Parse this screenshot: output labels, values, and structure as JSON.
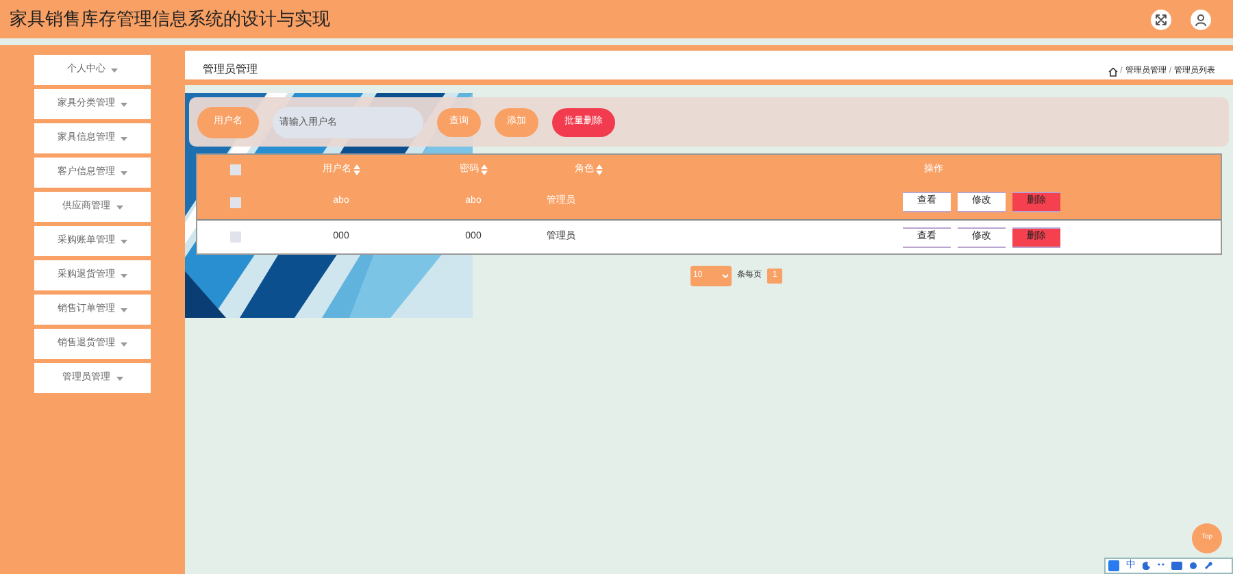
{
  "header": {
    "title": "家具销售库存管理信息系统的设计与实现"
  },
  "sidebar": {
    "items": [
      {
        "label": "个人中心"
      },
      {
        "label": "家具分类管理"
      },
      {
        "label": "家具信息管理"
      },
      {
        "label": "客户信息管理"
      },
      {
        "label": "供应商管理"
      },
      {
        "label": "采购账单管理"
      },
      {
        "label": "采购退货管理"
      },
      {
        "label": "销售订单管理"
      },
      {
        "label": "销售退货管理"
      },
      {
        "label": "管理员管理"
      }
    ]
  },
  "page_title": "管理员管理",
  "breadcrumb": [
    {
      "kind": "separator",
      "text": "/"
    },
    {
      "kind": "link",
      "text": "管理员管理"
    },
    {
      "kind": "separator",
      "text": "/"
    },
    {
      "kind": "link",
      "text": "管理员列表"
    }
  ],
  "search": {
    "label": "用户名",
    "placeholder": "请输入用户名",
    "buttons": [
      {
        "label": "查询",
        "kind": "normal"
      },
      {
        "label": "添加",
        "kind": "normal"
      },
      {
        "label": "批量删除",
        "kind": "danger"
      }
    ]
  },
  "table": {
    "all_checked": false,
    "columns": [
      "用户名",
      "密码",
      "角色",
      "操作"
    ],
    "rows": [
      {
        "selected": true,
        "checked": false,
        "cells": [
          "abo",
          "abo",
          "管理员"
        ],
        "actions": [
          {
            "label": "查看",
            "kind": "normal"
          },
          {
            "label": "修改",
            "kind": "normal"
          },
          {
            "label": "删除",
            "kind": "danger"
          }
        ]
      },
      {
        "selected": false,
        "checked": false,
        "cells": [
          "000",
          "000",
          "管理员"
        ],
        "actions": [
          {
            "label": "查看",
            "kind": "normal"
          },
          {
            "label": "修改",
            "kind": "normal"
          },
          {
            "label": "删除",
            "kind": "danger"
          }
        ]
      }
    ]
  },
  "pagination": {
    "page_size": "10",
    "page_size_label": "条每页",
    "pages": [
      {
        "label": "1",
        "selected": true
      }
    ]
  },
  "top_button": "Top",
  "ime_bar": {
    "mode": "中"
  }
}
